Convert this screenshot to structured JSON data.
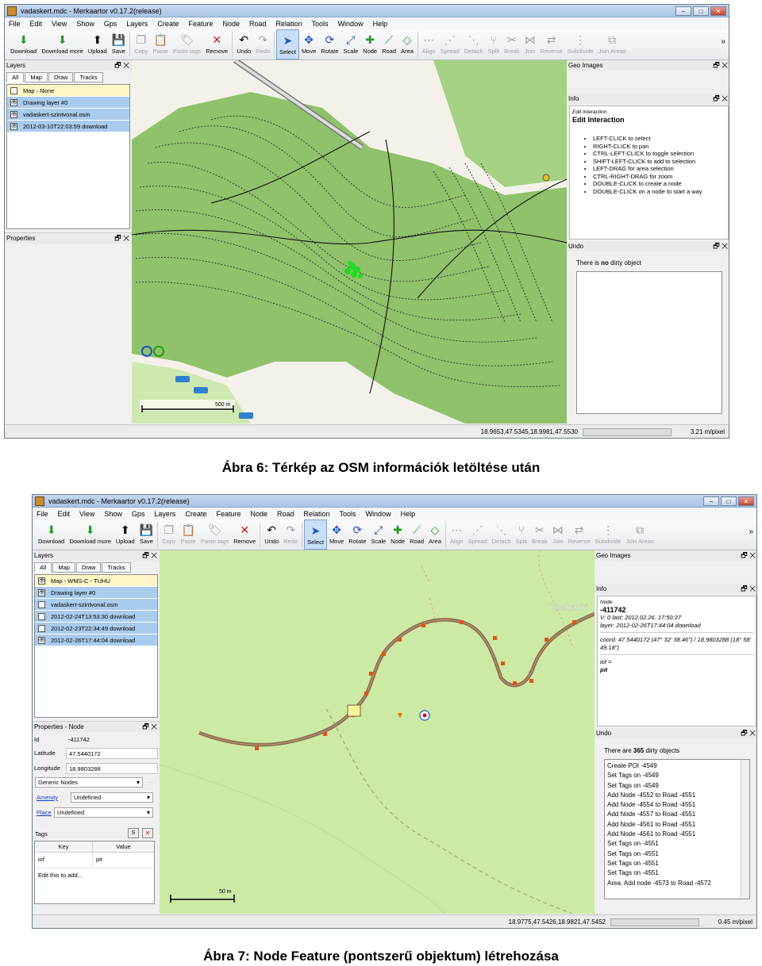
{
  "toolbar_items": [
    {
      "label": "Download",
      "icon": "download-icon",
      "glyph": "⬇",
      "color": "#2a9a2a",
      "disabled": false
    },
    {
      "label": "Download more",
      "icon": "download-more-icon",
      "glyph": "⬇",
      "color": "#2a9a2a",
      "disabled": false
    },
    {
      "label": "Upload",
      "icon": "upload-icon",
      "glyph": "⬆",
      "color": "#000",
      "disabled": false
    },
    {
      "label": "Save",
      "icon": "save-icon",
      "glyph": "💾",
      "color": "#000",
      "disabled": false
    },
    {
      "label": "Copy",
      "icon": "copy-icon",
      "glyph": "❐",
      "color": "#9ba0a8",
      "disabled": true
    },
    {
      "label": "Paste",
      "icon": "paste-icon",
      "glyph": "📋",
      "color": "#9ba0a8",
      "disabled": true
    },
    {
      "label": "Paste tags",
      "icon": "paste-tags-icon",
      "glyph": "🏷",
      "color": "#9ba0a8",
      "disabled": true
    },
    {
      "label": "Remove",
      "icon": "remove-icon",
      "glyph": "✕",
      "color": "#d01616",
      "disabled": false
    },
    {
      "label": "Undo",
      "icon": "undo-icon",
      "glyph": "↶",
      "color": "#000",
      "disabled": false
    },
    {
      "label": "Redo",
      "icon": "redo-icon",
      "glyph": "↷",
      "color": "#9ba0a8",
      "disabled": true
    },
    {
      "label": "Select",
      "icon": "select-arrow-icon",
      "glyph": "➤",
      "color": "#1d56b8",
      "disabled": false
    },
    {
      "label": "Move",
      "icon": "move-icon",
      "glyph": "✥",
      "color": "#1d56b8",
      "disabled": false
    },
    {
      "label": "Rotate",
      "icon": "rotate-icon",
      "glyph": "⟳",
      "color": "#1d56b8",
      "disabled": false
    },
    {
      "label": "Scale",
      "icon": "scale-icon",
      "glyph": "⤢",
      "color": "#1d56b8",
      "disabled": false
    },
    {
      "label": "Node",
      "icon": "node-icon",
      "glyph": "✚",
      "color": "#2a9a2a",
      "disabled": false
    },
    {
      "label": "Road",
      "icon": "road-icon",
      "glyph": "⟋",
      "color": "#2a9a2a",
      "disabled": false
    },
    {
      "label": "Area",
      "icon": "area-icon",
      "glyph": "◇",
      "color": "#2a9a2a",
      "disabled": false
    },
    {
      "label": "Align",
      "icon": "align-icon",
      "glyph": "⋯",
      "color": "#9ba0a8",
      "disabled": true
    },
    {
      "label": "Spread",
      "icon": "spread-icon",
      "glyph": "⋰",
      "color": "#9ba0a8",
      "disabled": true
    },
    {
      "label": "Detach",
      "icon": "detach-icon",
      "glyph": "⋱",
      "color": "#9ba0a8",
      "disabled": true
    },
    {
      "label": "Split",
      "icon": "split-icon",
      "glyph": "⑂",
      "color": "#9ba0a8",
      "disabled": true
    },
    {
      "label": "Break",
      "icon": "break-icon",
      "glyph": "✂",
      "color": "#9ba0a8",
      "disabled": true
    },
    {
      "label": "Join",
      "icon": "join-icon",
      "glyph": "⋈",
      "color": "#9ba0a8",
      "disabled": true
    },
    {
      "label": "Reverse",
      "icon": "reverse-icon",
      "glyph": "⇄",
      "color": "#9ba0a8",
      "disabled": true
    },
    {
      "label": "Subdivide",
      "icon": "subdivide-icon",
      "glyph": "⋮",
      "color": "#9ba0a8",
      "disabled": true
    },
    {
      "label": "Join Areas",
      "icon": "join-areas-icon",
      "glyph": "⧉",
      "color": "#9ba0a8",
      "disabled": true
    }
  ],
  "menus": [
    "File",
    "Edit",
    "View",
    "Show",
    "Gps",
    "Layers",
    "Create",
    "Feature",
    "Node",
    "Road",
    "Relation",
    "Tools",
    "Window",
    "Help"
  ],
  "window_title": "vadaskert.mdc - Merkaartor v0.17.2(release)",
  "win_buttons": {
    "min": "–",
    "max": "□",
    "close": "✕"
  },
  "tabs": [
    "All",
    "Map",
    "Draw",
    "Tracks"
  ],
  "more": "»",
  "dock_ctl": "🗗 ✕",
  "shot1": {
    "layers_title": "Layers",
    "layers": [
      {
        "name": "Map - None",
        "type": "map",
        "checked": false
      },
      {
        "name": "Drawing layer #0",
        "type": "sel",
        "checked": true
      },
      {
        "name": "vadaskert-szintvonal.osm",
        "type": "sel",
        "checked": true
      },
      {
        "name": "2012-03-10T22:03:59 download",
        "type": "sel",
        "checked": true
      }
    ],
    "properties_title": "Properties",
    "geo_images_title": "Geo Images",
    "info_title": "Info",
    "info_small": "Edit Interaction",
    "info_heading": "Edit Interaction",
    "info_lines": [
      "LEFT-CLICK to select",
      "RIGHT-CLICK to pan",
      "CTRL-LEFT-CLICK to toggle selection",
      "SHIFT-LEFT-CLICK to add to selection",
      "LEFT-DRAG for area selection",
      "CTRL-RIGHT-DRAG for zoom",
      "DOUBLE-CLICK to create a node",
      "DOUBLE-CLICK on a node to start a way"
    ],
    "undo_title": "Undo",
    "undo_pre": "There is ",
    "undo_bold": "no",
    "undo_post": " dirty object",
    "scale_label": "500 m",
    "status_coords": "18.9653,47.5345,18.9981,47.5530",
    "status_scale": "3.21 m/pixel"
  },
  "caption1": "Ábra 6: Térkép az OSM információk letöltése után",
  "shot2": {
    "layers_title": "Layers",
    "layers": [
      {
        "name": "Map - WMS-C - TUHU",
        "type": "map",
        "checked": true
      },
      {
        "name": "Drawing layer #0",
        "type": "sel",
        "checked": true
      },
      {
        "name": "vadaskert-szintvonal.osm",
        "type": "sel",
        "checked": false
      },
      {
        "name": "2012-02-24T13:53:30 download",
        "type": "sel",
        "checked": false
      },
      {
        "name": "2012-02-23T22:34:49 download",
        "type": "sel",
        "checked": false
      },
      {
        "name": "2012-02-26T17:44:04 download",
        "type": "sel",
        "checked": true
      }
    ],
    "properties_title": "Properties - Node",
    "prop_id_label": "Id",
    "prop_id": "-411742",
    "prop_lat_label": "Latitude",
    "prop_lat": "47.5440172",
    "prop_lon_label": "Longitude",
    "prop_lon": "18.9803288",
    "preset": "Generic Nodes",
    "amenity_label": "Amenity",
    "amenity_value": "Undefined",
    "place_label": "Place",
    "place_value": "Undefined",
    "tags_label": "Tags",
    "tags_btn_s": "S",
    "tags_btn_x": "✕",
    "tags_key_header": "Key",
    "tags_value_header": "Value",
    "tag_key": "iof",
    "tag_value": "pit",
    "tag_edit": "Edit this to add...",
    "geo_images_title": "Geo Images",
    "info_title": "Info",
    "info_node_label": "Node",
    "info_node_id": "-411742",
    "info_v_line": "V: 0 last: 2012.02.26. 17:50:37",
    "info_layer_line": "layer: 2012-02-26T17:44:04 download",
    "info_coord": "coord: 47.5440172 (47° 32' 38.46\") / 18.9803288 (18° 58' 49.18\")",
    "info_tag1": "iof =",
    "info_tag2": "pit",
    "undo_title": "Undo",
    "undo_pre": "There are ",
    "undo_bold": "365",
    "undo_post": " dirty objects",
    "undo_items": [
      "Create POI -4549",
      "Set Tags on -4549",
      "Set Tags on -4549",
      "Add Node -4552 to Road -4551",
      "Add Node -4554 to Road -4551",
      "Add Node -4557 to Road -4551",
      "Add Node -4561 to Road -4551",
      "Add Node -4561 to Road -4551",
      "Set Tags on -4551",
      "Set Tags on -4551",
      "Set Tags on -4551",
      "Set Tags on -4551",
      "Area: Add node -4573 to Road -4572"
    ],
    "map_label": "Útbaigazító",
    "scale_label": "50 m",
    "status_coords": "18.9775,47.5426,18.9821,47.5452",
    "status_scale": "0.45 m/pixel"
  },
  "caption2": "Ábra 7: Node Feature (pontszerű objektum) létrehozása",
  "colors": {
    "layer_selected": "#a9cbee",
    "layer_map": "#fff6c6",
    "forest": "#8fc26b",
    "map2_bg": "#cdeaa5",
    "road": "#8a5a3a",
    "node": "#e0541a"
  }
}
